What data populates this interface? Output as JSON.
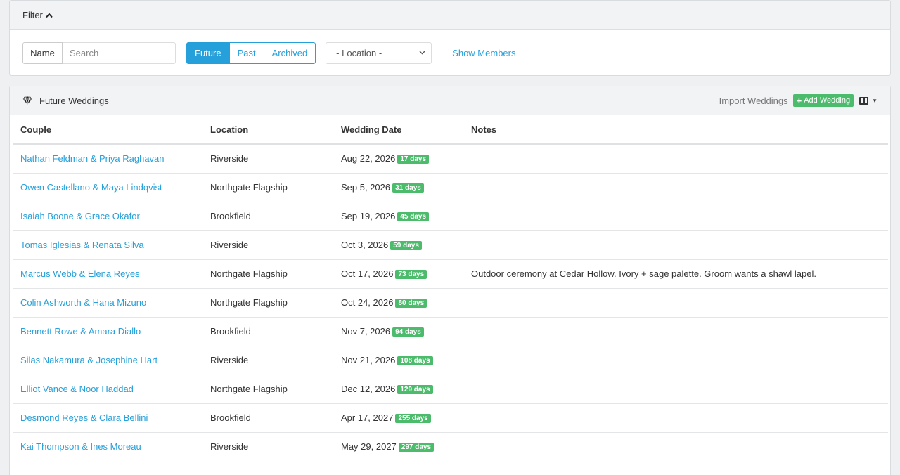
{
  "filter": {
    "title": "Filter",
    "name_label": "Name",
    "search_placeholder": "Search",
    "segments": [
      "Future",
      "Past",
      "Archived"
    ],
    "active_segment": "Future",
    "location_select": "- Location -",
    "show_members": "Show Members"
  },
  "list": {
    "title": "Future Weddings",
    "import_label": "Import Weddings",
    "add_label": "Add Wedding",
    "columns": [
      "Couple",
      "Location",
      "Wedding Date",
      "Notes"
    ],
    "rows": [
      {
        "couple": "Nathan Feldman & Priya Raghavan",
        "location": "Riverside",
        "date": "Aug 22, 2026",
        "days": "17 days",
        "notes": ""
      },
      {
        "couple": "Owen Castellano & Maya Lindqvist",
        "location": "Northgate Flagship",
        "date": "Sep 5, 2026",
        "days": "31 days",
        "notes": ""
      },
      {
        "couple": "Isaiah Boone & Grace Okafor",
        "location": "Brookfield",
        "date": "Sep 19, 2026",
        "days": "45 days",
        "notes": ""
      },
      {
        "couple": "Tomas Iglesias & Renata Silva",
        "location": "Riverside",
        "date": "Oct 3, 2026",
        "days": "59 days",
        "notes": ""
      },
      {
        "couple": "Marcus Webb & Elena Reyes",
        "location": "Northgate Flagship",
        "date": "Oct 17, 2026",
        "days": "73 days",
        "notes": "Outdoor ceremony at Cedar Hollow. Ivory + sage palette. Groom wants a shawl lapel."
      },
      {
        "couple": "Colin Ashworth & Hana Mizuno",
        "location": "Northgate Flagship",
        "date": "Oct 24, 2026",
        "days": "80 days",
        "notes": ""
      },
      {
        "couple": "Bennett Rowe & Amara Diallo",
        "location": "Brookfield",
        "date": "Nov 7, 2026",
        "days": "94 days",
        "notes": ""
      },
      {
        "couple": "Silas Nakamura & Josephine Hart",
        "location": "Riverside",
        "date": "Nov 21, 2026",
        "days": "108 days",
        "notes": ""
      },
      {
        "couple": "Elliot Vance & Noor Haddad",
        "location": "Northgate Flagship",
        "date": "Dec 12, 2026",
        "days": "129 days",
        "notes": ""
      },
      {
        "couple": "Desmond Reyes & Clara Bellini",
        "location": "Brookfield",
        "date": "Apr 17, 2027",
        "days": "255 days",
        "notes": ""
      },
      {
        "couple": "Kai Thompson & Ines Moreau",
        "location": "Riverside",
        "date": "May 29, 2027",
        "days": "297 days",
        "notes": ""
      }
    ]
  },
  "icons": {
    "filter_toggle": "chevron-up-icon",
    "list": "diamond-icon",
    "add": "plus-icon",
    "columns": "columns-icon"
  },
  "colors": {
    "accent": "#26a0da",
    "badge": "#4cbb6c",
    "heading_bg": "#f2f3f4"
  }
}
